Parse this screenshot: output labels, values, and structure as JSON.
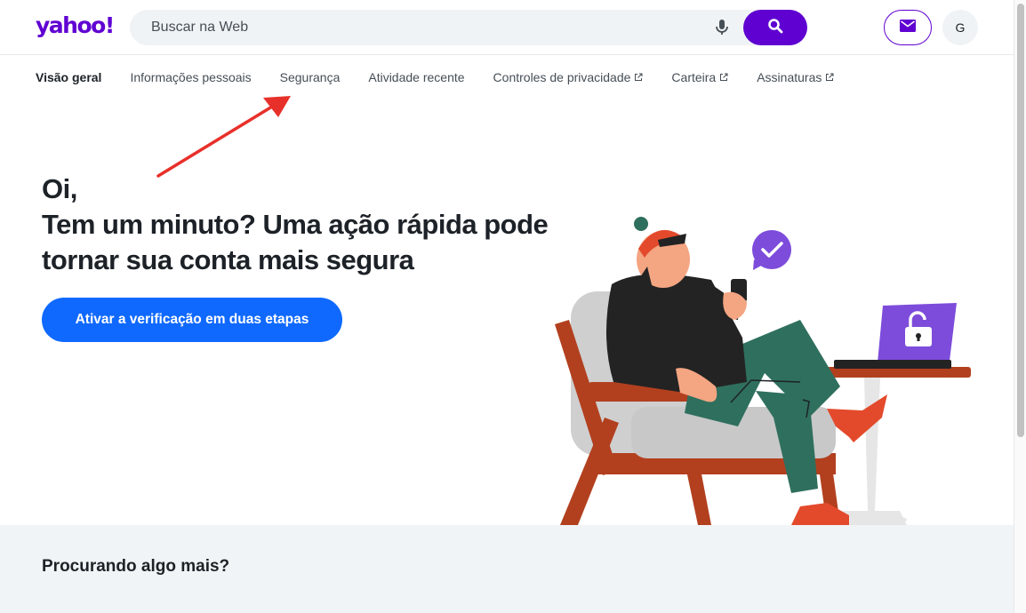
{
  "header": {
    "logo_text": "yahoo!",
    "search_placeholder": "Buscar na Web",
    "avatar_initial": "G"
  },
  "nav": {
    "items": [
      {
        "label": "Visão geral",
        "active": true,
        "external": false
      },
      {
        "label": "Informações pessoais",
        "active": false,
        "external": false
      },
      {
        "label": "Segurança",
        "active": false,
        "external": false
      },
      {
        "label": "Atividade recente",
        "active": false,
        "external": false
      },
      {
        "label": "Controles de privacidade",
        "active": false,
        "external": true
      },
      {
        "label": "Carteira",
        "active": false,
        "external": true
      },
      {
        "label": "Assinaturas",
        "active": false,
        "external": true
      }
    ]
  },
  "hero": {
    "greeting": "Oi,",
    "message": "Tem um minuto? Uma ação rápida pode tornar sua conta mais segura",
    "cta_label": "Ativar a verificação em duas etapas"
  },
  "bottom": {
    "title": "Procurando algo mais?"
  },
  "icons": {
    "mic": "microphone-icon",
    "search": "search-icon",
    "mail": "mail-icon",
    "external": "external-link-icon"
  },
  "colors": {
    "brand": "#6001d2",
    "cta": "#0f69ff",
    "annotation": "#e8302a"
  }
}
